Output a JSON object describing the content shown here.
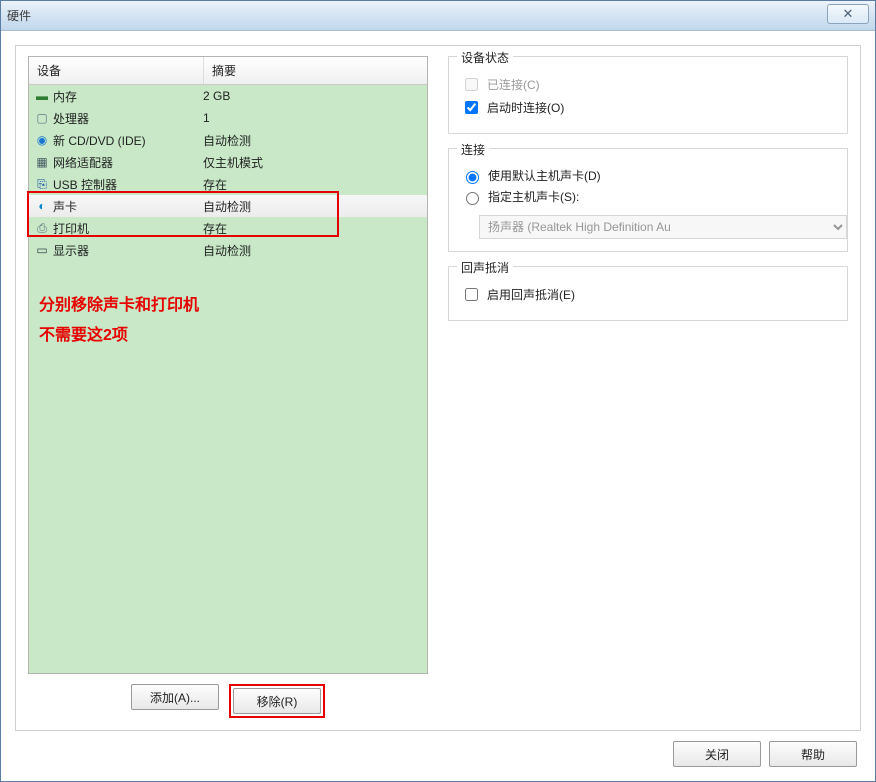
{
  "window": {
    "title": "硬件",
    "close_glyph": "✕"
  },
  "table": {
    "header_device": "设备",
    "header_summary": "摘要",
    "rows": [
      {
        "icon": "memory-icon",
        "name": "内存",
        "summary": "2 GB"
      },
      {
        "icon": "cpu-icon",
        "name": "处理器",
        "summary": "1"
      },
      {
        "icon": "cd-icon",
        "name": "新 CD/DVD (IDE)",
        "summary": "自动检测"
      },
      {
        "icon": "nic-icon",
        "name": "网络适配器",
        "summary": "仅主机模式"
      },
      {
        "icon": "usb-icon",
        "name": "USB 控制器",
        "summary": "存在"
      },
      {
        "icon": "sound-icon",
        "name": "声卡",
        "summary": "自动检测"
      },
      {
        "icon": "printer-icon",
        "name": "打印机",
        "summary": "存在"
      },
      {
        "icon": "display-icon",
        "name": "显示器",
        "summary": "自动检测"
      }
    ]
  },
  "annotations": {
    "line1": "分别移除声卡和打印机",
    "line2": "不需要这2项"
  },
  "buttons": {
    "add": "添加(A)...",
    "remove": "移除(R)",
    "close": "关闭",
    "help": "帮助"
  },
  "group_status": {
    "legend": "设备状态",
    "connected": "已连接(C)",
    "connect_at_poweron": "启动时连接(O)"
  },
  "group_connection": {
    "legend": "连接",
    "use_default": "使用默认主机声卡(D)",
    "specify": "指定主机声卡(S):",
    "combo_value": "扬声器 (Realtek High Definition Au"
  },
  "group_echo": {
    "legend": "回声抵消",
    "enable": "启用回声抵消(E)"
  },
  "icons": {
    "memory-icon": "▬",
    "cpu-icon": "▢",
    "cd-icon": "◉",
    "nic-icon": "▦",
    "usb-icon": "⎘",
    "sound-icon": "◐",
    "printer-icon": "⎙",
    "display-icon": "▭"
  },
  "icon_colors": {
    "memory-icon": "#2e7d32",
    "cpu-icon": "#607d8b",
    "cd-icon": "#1976d2",
    "nic-icon": "#455a64",
    "usb-icon": "#0d47a1",
    "sound-icon": "#0288d1",
    "printer-icon": "#546e7a",
    "display-icon": "#37474f"
  }
}
